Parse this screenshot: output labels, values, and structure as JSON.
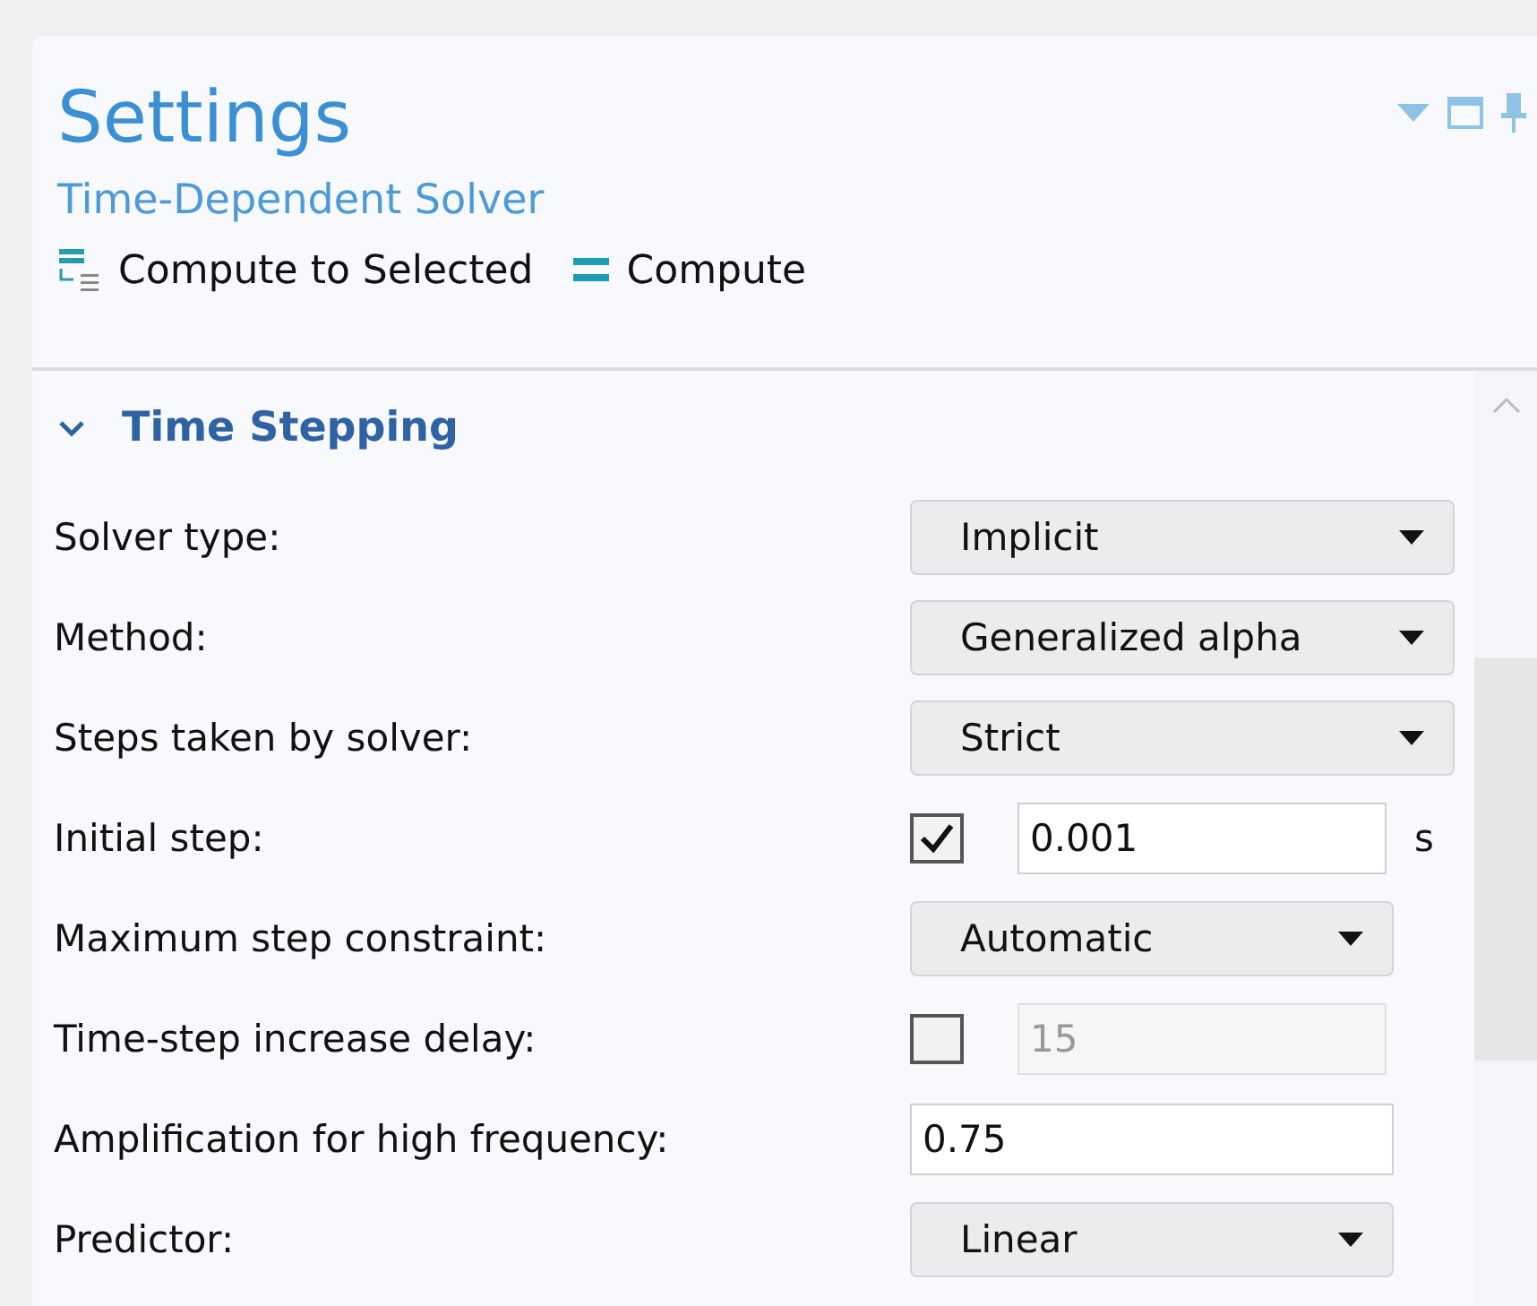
{
  "panel": {
    "title": "Settings",
    "subtitle": "Time-Dependent Solver"
  },
  "toolbar": [
    {
      "kind": "compute-selected",
      "label": "Compute to Selected"
    },
    {
      "kind": "compute",
      "label": "Compute"
    }
  ],
  "section": {
    "title": "Time Stepping",
    "expanded": true,
    "rows": [
      {
        "label": "Solver type:",
        "kind": "select-wide",
        "value": "Implicit"
      },
      {
        "label": "Method:",
        "kind": "select-wide",
        "value": "Generalized alpha"
      },
      {
        "label": "Steps taken by solver:",
        "kind": "select-wide",
        "value": "Strict"
      },
      {
        "label": "Initial step:",
        "kind": "check-field",
        "checked": true,
        "value": "0.001",
        "disabled": false,
        "unit": "s"
      },
      {
        "label": "Maximum step constraint:",
        "kind": "select",
        "value": "Automatic"
      },
      {
        "label": "Time-step increase delay:",
        "kind": "check-field",
        "checked": false,
        "value": "15",
        "disabled": true
      },
      {
        "label": "Amplification for high frequency:",
        "kind": "field",
        "value": "0.75"
      },
      {
        "label": "Predictor:",
        "kind": "select",
        "value": "Linear"
      }
    ]
  }
}
